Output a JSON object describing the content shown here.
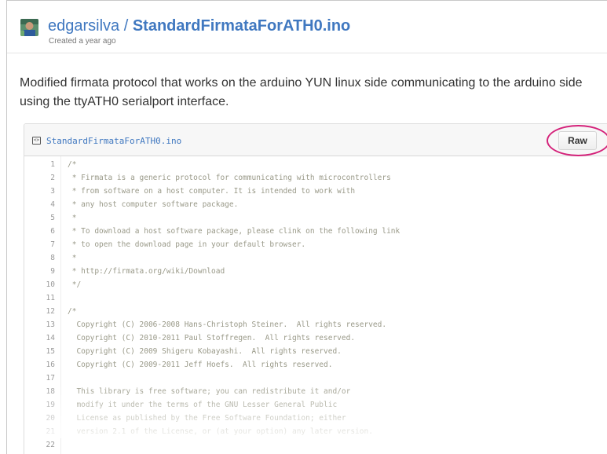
{
  "gist": {
    "owner": "edgarsilva",
    "separator": " / ",
    "name": "StandardFirmataForATH0.ino",
    "created": "Created a year ago",
    "description": "Modified firmata protocol that works on the arduino YUN linux side communicating to the arduino side using the ttyATH0 serialport interface."
  },
  "file": {
    "icon": "code-file-icon",
    "name": "StandardFirmataForATH0.ino",
    "raw_label": "Raw"
  },
  "colors": {
    "link": "#4078c0",
    "comment": "#999988",
    "highlight_ring": "#d4227a"
  },
  "code_lines": [
    {
      "n": "1",
      "text": "/*"
    },
    {
      "n": "2",
      "text": " * Firmata is a generic protocol for communicating with microcontrollers"
    },
    {
      "n": "3",
      "text": " * from software on a host computer. It is intended to work with"
    },
    {
      "n": "4",
      "text": " * any host computer software package."
    },
    {
      "n": "5",
      "text": " *"
    },
    {
      "n": "6",
      "text": " * To download a host software package, please clink on the following link"
    },
    {
      "n": "7",
      "text": " * to open the download page in your default browser."
    },
    {
      "n": "8",
      "text": " *"
    },
    {
      "n": "9",
      "text": " * http://firmata.org/wiki/Download"
    },
    {
      "n": "10",
      "text": " */"
    },
    {
      "n": "11",
      "text": ""
    },
    {
      "n": "12",
      "text": "/*"
    },
    {
      "n": "13",
      "text": "  Copyright (C) 2006-2008 Hans-Christoph Steiner.  All rights reserved."
    },
    {
      "n": "14",
      "text": "  Copyright (C) 2010-2011 Paul Stoffregen.  All rights reserved."
    },
    {
      "n": "15",
      "text": "  Copyright (C) 2009 Shigeru Kobayashi.  All rights reserved."
    },
    {
      "n": "16",
      "text": "  Copyright (C) 2009-2011 Jeff Hoefs.  All rights reserved."
    },
    {
      "n": "17",
      "text": ""
    },
    {
      "n": "18",
      "text": "  This library is free software; you can redistribute it and/or"
    },
    {
      "n": "19",
      "text": "  modify it under the terms of the GNU Lesser General Public"
    },
    {
      "n": "20",
      "text": "  License as published by the Free Software Foundation; either"
    },
    {
      "n": "21",
      "text": "  version 2.1 of the License, or (at your option) any later version."
    },
    {
      "n": "22",
      "text": ""
    }
  ]
}
